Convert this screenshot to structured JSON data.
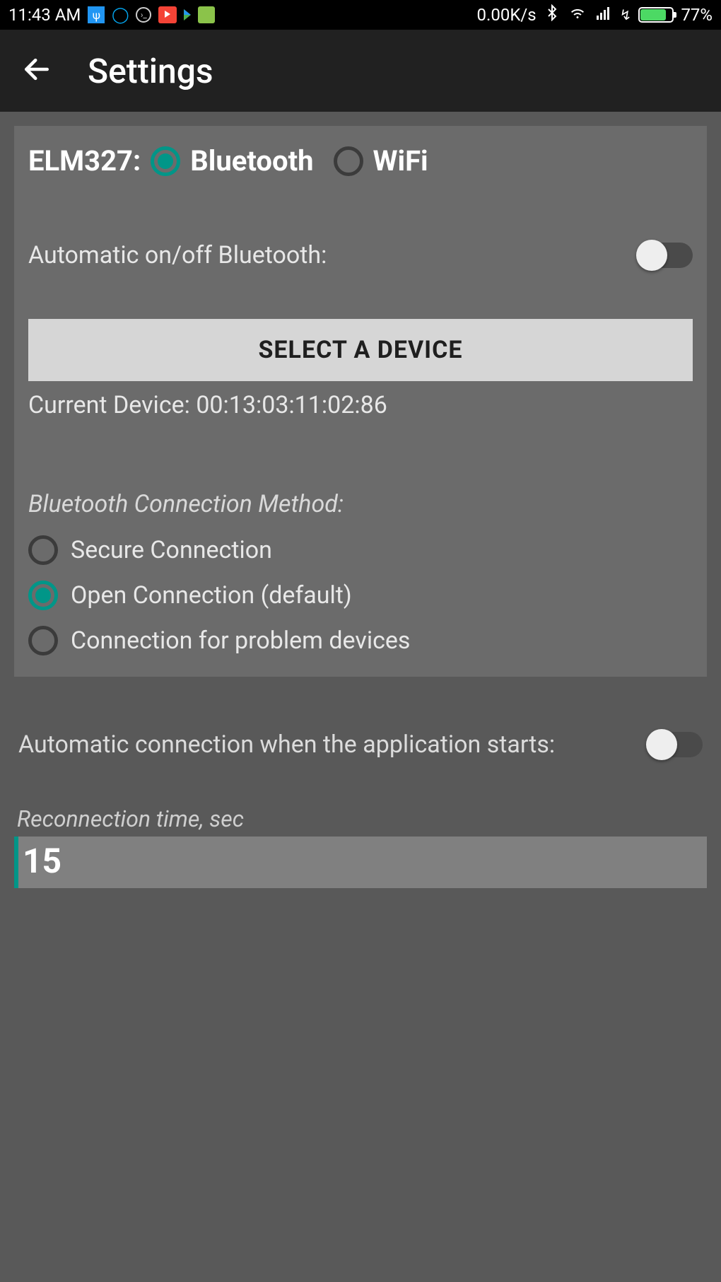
{
  "status": {
    "time": "11:43 AM",
    "net_speed": "0.00K/s",
    "battery_pct": "77%"
  },
  "appbar": {
    "title": "Settings"
  },
  "elm": {
    "label": "ELM327:",
    "options": {
      "bluetooth": "Bluetooth",
      "wifi": "WiFi"
    }
  },
  "auto_bt": {
    "label": "Automatic on/off Bluetooth:"
  },
  "select_device": {
    "button": "SELECT A DEVICE",
    "current_prefix": "Current Device: ",
    "current_value": "00:13:03:11:02:86"
  },
  "method": {
    "title": "Bluetooth Connection Method:",
    "options": {
      "secure": "Secure Connection",
      "open": "Open Connection (default)",
      "problem": "Connection for problem devices"
    }
  },
  "auto_conn": {
    "label": "Automatic connection when the application starts:"
  },
  "reconnect": {
    "title": "Reconnection time, sec",
    "value": "15"
  }
}
